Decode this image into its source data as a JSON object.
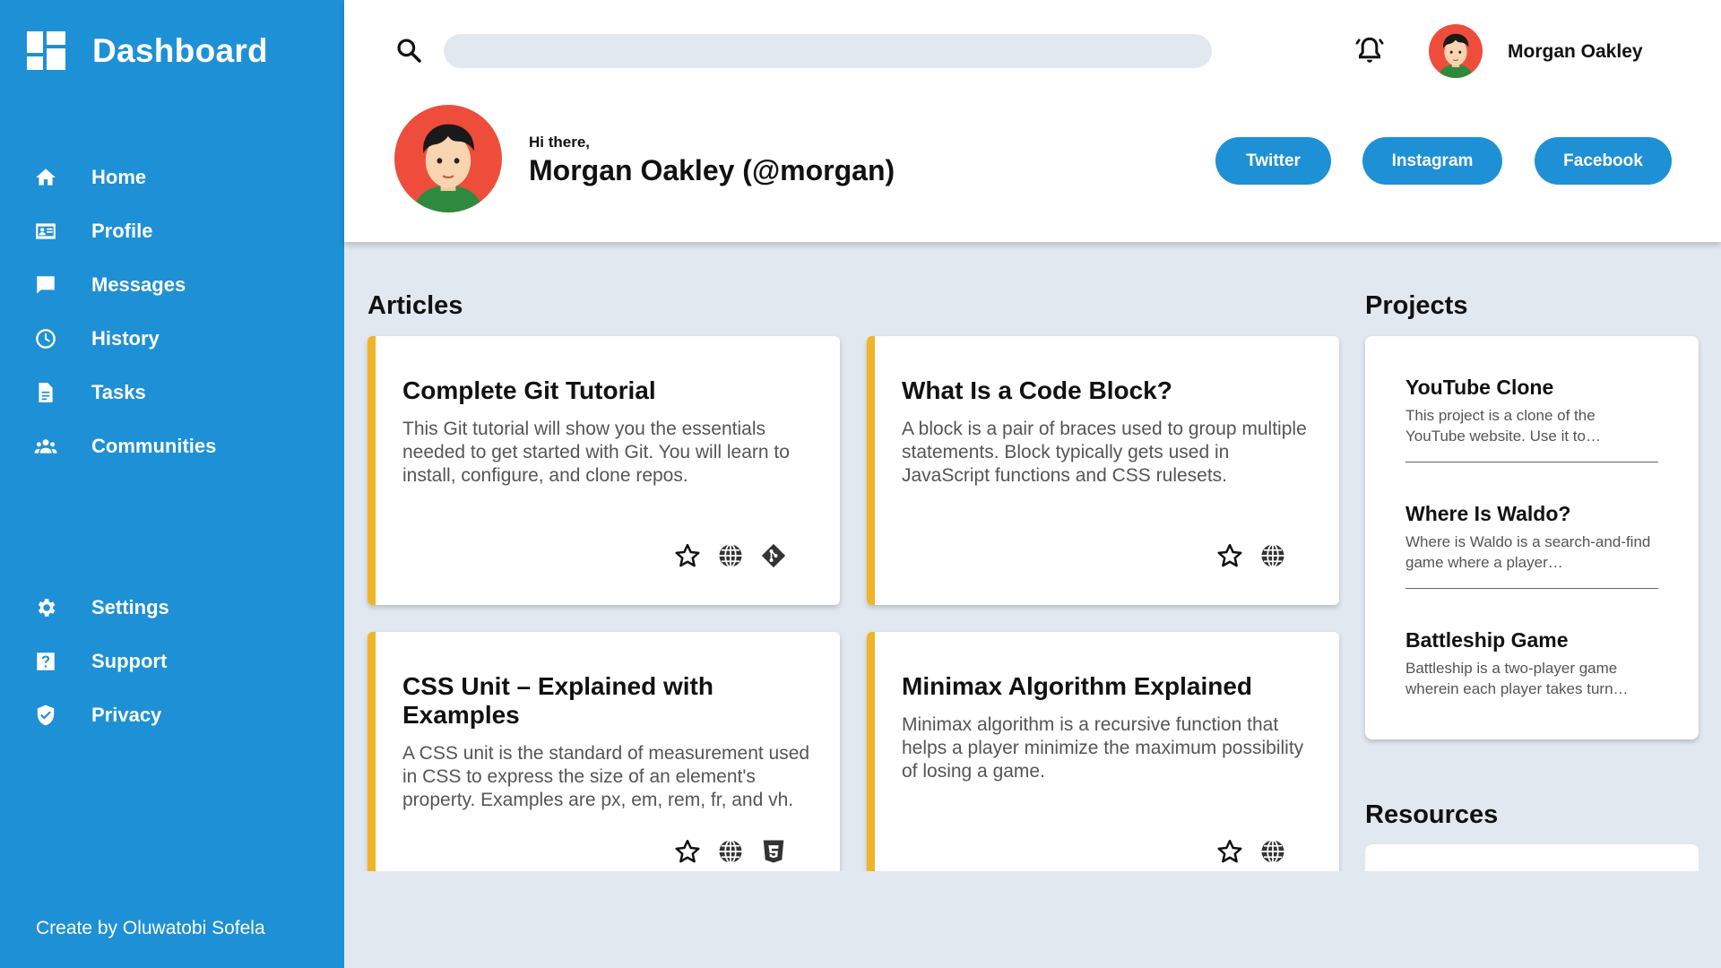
{
  "sidebar": {
    "title": "Dashboard",
    "items": [
      {
        "label": "Home",
        "icon": "home-icon"
      },
      {
        "label": "Profile",
        "icon": "id-card-icon"
      },
      {
        "label": "Messages",
        "icon": "chat-icon"
      },
      {
        "label": "History",
        "icon": "clock-icon"
      },
      {
        "label": "Tasks",
        "icon": "document-icon"
      },
      {
        "label": "Communities",
        "icon": "people-icon"
      }
    ],
    "bottom_items": [
      {
        "label": "Settings",
        "icon": "gear-icon"
      },
      {
        "label": "Support",
        "icon": "question-icon"
      },
      {
        "label": "Privacy",
        "icon": "shield-icon"
      }
    ],
    "credit": "Create by Oluwatobi Sofela"
  },
  "header": {
    "search_placeholder": "",
    "user_name": "Morgan Oakley",
    "greeting": "Hi there,",
    "full_name": "Morgan Oakley (@morgan)",
    "buttons": {
      "twitter": "Twitter",
      "instagram": "Instagram",
      "facebook": "Facebook"
    }
  },
  "articles": {
    "title": "Articles",
    "items": [
      {
        "title": "Complete Git Tutorial",
        "description": "This Git tutorial will show you the essentials needed to get started with Git. You will learn to install, configure, and clone repos.",
        "actions": [
          "star-icon",
          "globe-icon",
          "git-icon"
        ]
      },
      {
        "title": "What Is a Code Block?",
        "description": "A block is a pair of braces used to group multiple statements. Block typically gets used in JavaScript functions and CSS rulesets.",
        "actions": [
          "star-icon",
          "globe-icon"
        ]
      },
      {
        "title": "CSS Unit – Explained with Examples",
        "description": "A CSS unit is the standard of measurement used in CSS to express the size of an element's property. Examples are px, em, rem, fr, and vh.",
        "actions": [
          "star-icon",
          "globe-icon",
          "css3-icon"
        ]
      },
      {
        "title": "Minimax Algorithm Explained",
        "description": "Minimax algorithm is a recursive function that helps a player minimize the maximum possibility of losing a game.",
        "actions": [
          "star-icon",
          "globe-icon"
        ]
      }
    ]
  },
  "projects": {
    "title": "Projects",
    "items": [
      {
        "title": "YouTube Clone",
        "description": "This project is a clone of the YouTube website. Use it to…"
      },
      {
        "title": "Where Is Waldo?",
        "description": "Where is Waldo is a search-and-find game where a player…"
      },
      {
        "title": "Battleship Game",
        "description": "Battleship is a two-player game wherein each player takes turn…"
      }
    ]
  },
  "resources": {
    "title": "Resources"
  },
  "colors": {
    "sidebar": "#1e90d5",
    "accent_border": "#f0b429",
    "background": "#e2e8f0"
  }
}
